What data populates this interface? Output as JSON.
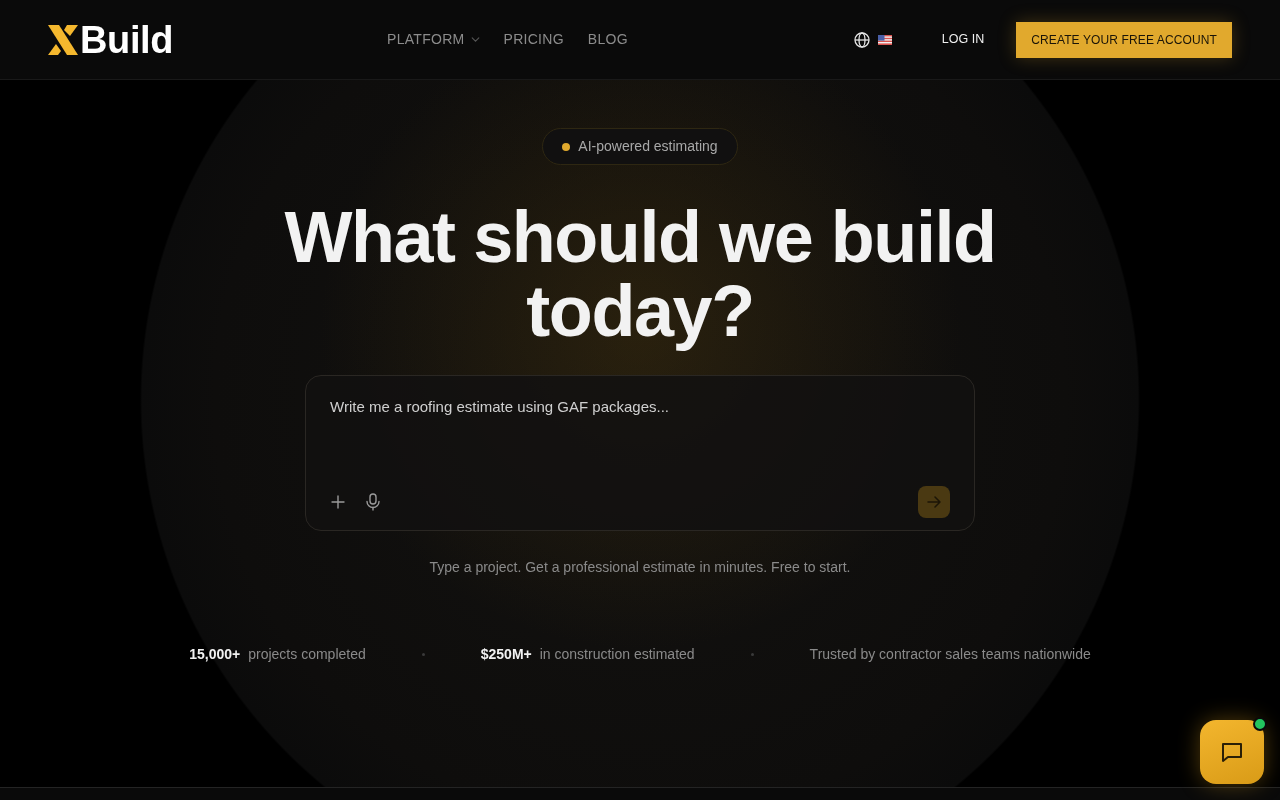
{
  "header": {
    "brand": "Build",
    "nav": [
      {
        "label": "PLATFORM",
        "has_menu": true
      },
      {
        "label": "PRICING",
        "has_menu": false
      },
      {
        "label": "BLOG",
        "has_menu": false
      }
    ],
    "login": "LOG IN",
    "cta": "CREATE YOUR FREE ACCOUNT"
  },
  "hero": {
    "badge": "AI-powered estimating",
    "headline": "What should we build today?",
    "prompt": {
      "placeholder": "Write me a roofing estimate using GAF packages...",
      "send_disabled": true
    },
    "caption": "Type a project. Get a professional estimate in minutes. Free to start.",
    "stats": [
      {
        "value": "15,000+",
        "label": "projects completed"
      },
      {
        "value": "$250M+",
        "label": "in construction estimated"
      },
      {
        "label": "Trusted by contractor sales teams nationwide"
      }
    ]
  },
  "chat": {
    "online": true
  }
}
